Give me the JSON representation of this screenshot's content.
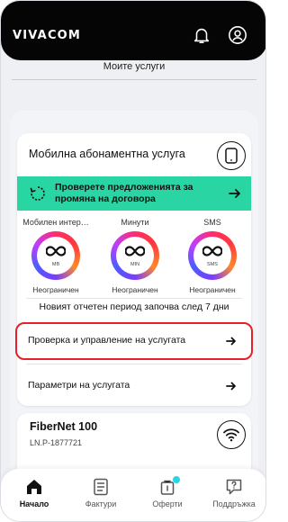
{
  "header": {
    "brand": "VIVACOM"
  },
  "page": {
    "title": "Моите услуги"
  },
  "mobile_card": {
    "title": "Мобилна абонаментна услуга",
    "promo_text": "Проверете предложенията за промяна на договора",
    "usage": [
      {
        "label": "Мобилен интер…",
        "unit": "MB",
        "status": "Неограничен"
      },
      {
        "label": "Минути",
        "unit": "MIN",
        "status": "Неограничен"
      },
      {
        "label": "SMS",
        "unit": "SMS",
        "status": "Неограничен"
      }
    ],
    "period_text": "Новият отчетен период започва след 7 дни",
    "rows": [
      {
        "label": "Проверка и управление на услугата"
      },
      {
        "label": "Параметри на услугата"
      }
    ]
  },
  "fiber_card": {
    "title": "FiberNet 100",
    "account": "LN.P-1877721"
  },
  "nav": [
    {
      "label": "Начало",
      "active": true
    },
    {
      "label": "Фактури"
    },
    {
      "label": "Оферти"
    },
    {
      "label": "Поддръжка"
    }
  ],
  "colors": {
    "accent": "#29d6a3",
    "highlight": "#e5202a",
    "header": "#050505"
  }
}
